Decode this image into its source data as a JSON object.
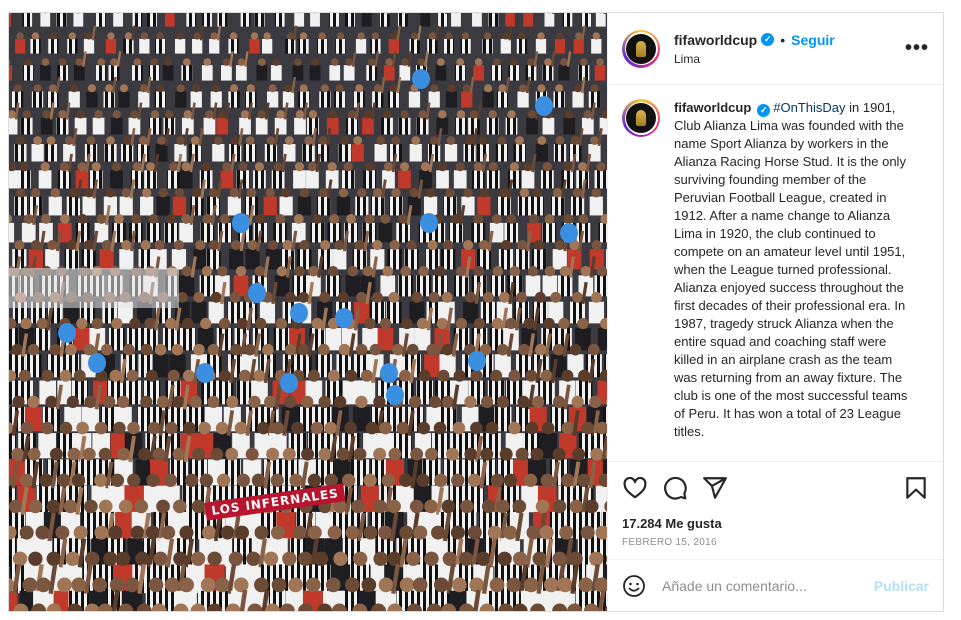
{
  "post": {
    "photo": {
      "banner_text": "LOS INFERNALES"
    },
    "header": {
      "username": "fifaworldcup",
      "separator": "•",
      "follow_label": "Seguir",
      "location": "Lima",
      "more_label": "•••"
    },
    "caption": {
      "username": "fifaworldcup",
      "hashtag": "#OnThisDay",
      "text": " in 1901, Club Alianza Lima was founded with the name Sport Alianza by workers in the Alianza Racing Horse Stud. It is the only surviving founding member of the Peruvian Football League, created in 1912. After a name change to Alianza Lima in 1920, the club continued to compete on an amateur level until 1951, when the League turned professional. Alianza enjoyed success throughout the first decades of their professional era. In 1987, tragedy struck Alianza when the entire squad and coaching staff were killed in an airplane crash as the team was returning from an away fixture. The club is one of the most successful teams of Peru. It has won a total of 23 League titles."
    },
    "actions": {
      "likes": "17.284 Me gusta",
      "date": "FEBRERO 15, 2016"
    },
    "comment": {
      "placeholder": "Añade un comentario...",
      "publish_label": "Publicar"
    },
    "icons": {
      "like": "heart-icon",
      "comment": "comment-icon",
      "share": "share-icon",
      "save": "bookmark-icon",
      "emoji": "emoji-icon",
      "verified": "verified-badge-icon"
    },
    "colors": {
      "link_blue": "#0095f6",
      "hashtag": "#00376b",
      "publish_disabled": "#b2dffc",
      "muted": "#8e8e8e"
    }
  }
}
